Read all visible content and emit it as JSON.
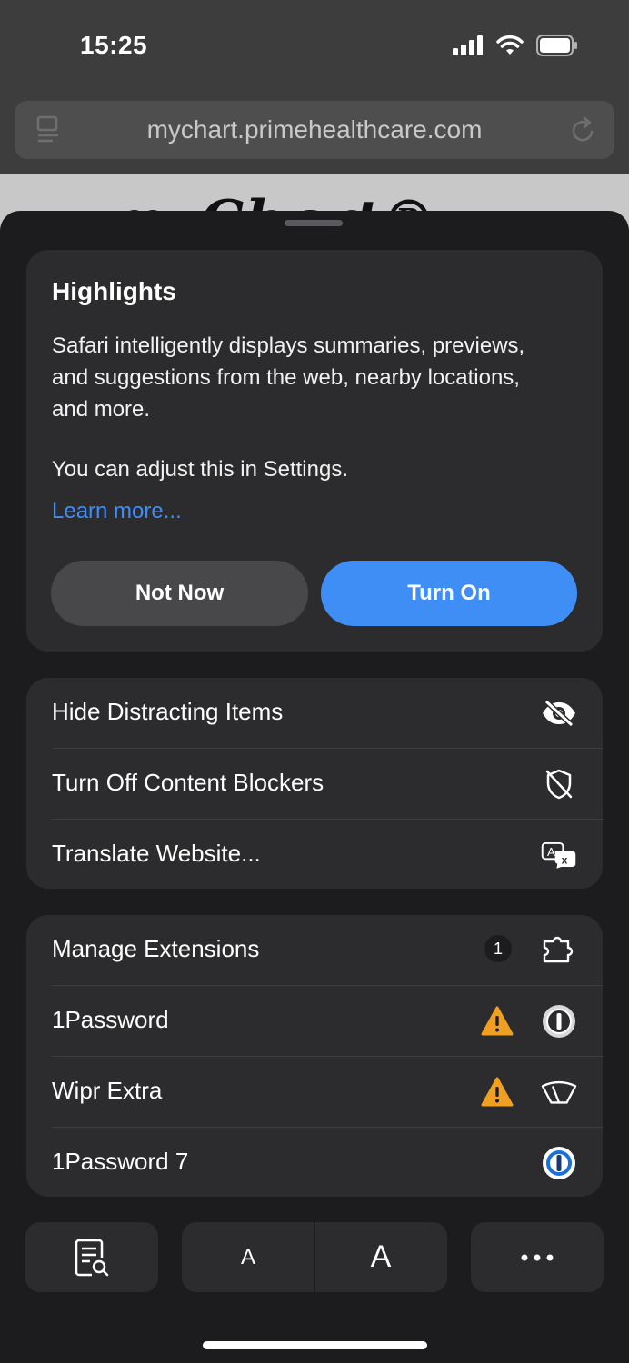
{
  "status": {
    "time": "15:25"
  },
  "browser": {
    "url": "mychart.primehealthcare.com"
  },
  "web_peek": {
    "logo_text": "myChart®"
  },
  "highlights": {
    "title": "Highlights",
    "body": "Safari intelligently displays summaries, previews, and suggestions from the web, nearby locations, and more.",
    "adjust": "You can adjust this in Settings.",
    "learn_more": "Learn more...",
    "not_now": "Not Now",
    "turn_on": "Turn On"
  },
  "menu1": {
    "items": [
      {
        "label": "Hide Distracting Items",
        "icon": "eye-slash-icon"
      },
      {
        "label": "Turn Off Content Blockers",
        "icon": "shield-slash-icon"
      },
      {
        "label": "Translate Website...",
        "icon": "translate-icon"
      }
    ]
  },
  "menu2": {
    "items": [
      {
        "label": "Manage Extensions",
        "icon": "puzzle-icon",
        "badge": "1"
      },
      {
        "label": "1Password",
        "icon": "onepassword-icon",
        "warning": true
      },
      {
        "label": "Wipr Extra",
        "icon": "wiper-icon",
        "warning": true
      },
      {
        "label": "1Password 7",
        "icon": "onepassword-blue-icon"
      }
    ]
  },
  "toolbar": {
    "font_small": "A",
    "font_large": "A"
  },
  "colors": {
    "accent": "#3f8ef5",
    "warning": "#f0a020",
    "sheet": "#1c1c1e",
    "card": "#2c2c2e"
  }
}
